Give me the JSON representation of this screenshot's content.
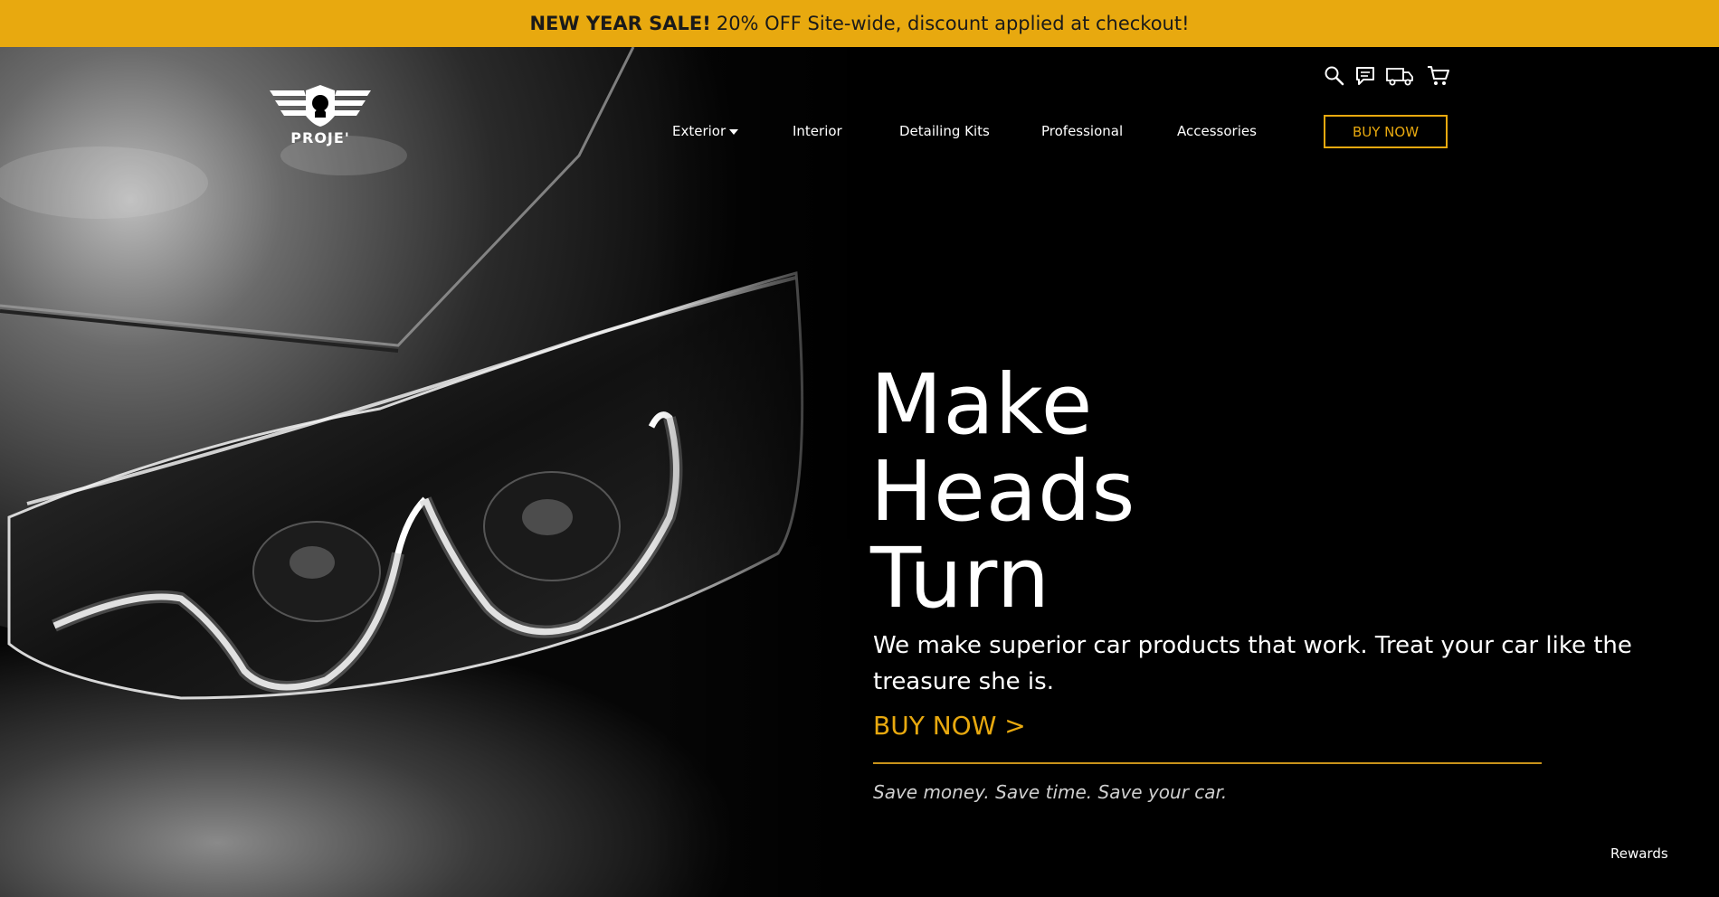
{
  "promo": {
    "bold": "NEW YEAR SALE!",
    "text": "20% OFF Site-wide, discount applied at checkout!"
  },
  "brand": {
    "logo_text": "PROJE'"
  },
  "nav": {
    "items": [
      {
        "label": "Exterior"
      },
      {
        "label": "Interior"
      },
      {
        "label": "Detailing Kits"
      },
      {
        "label": "Professional"
      },
      {
        "label": "Accessories"
      }
    ],
    "buy_label": "BUY NOW"
  },
  "utility_icons": [
    "search-icon",
    "chat-icon",
    "truck-icon",
    "cart-icon"
  ],
  "hero": {
    "headline_lines": [
      "Make",
      "Heads",
      "Turn"
    ],
    "subtext": "We make superior car products that work. Treat your car like the treasure she is.",
    "cta": "BUY NOW  >",
    "tagline": "Save money. Save time. Save your car."
  },
  "rewards": "Rewards",
  "colors": {
    "accent": "#e8a90f",
    "background": "#000000",
    "text": "#ffffff"
  }
}
